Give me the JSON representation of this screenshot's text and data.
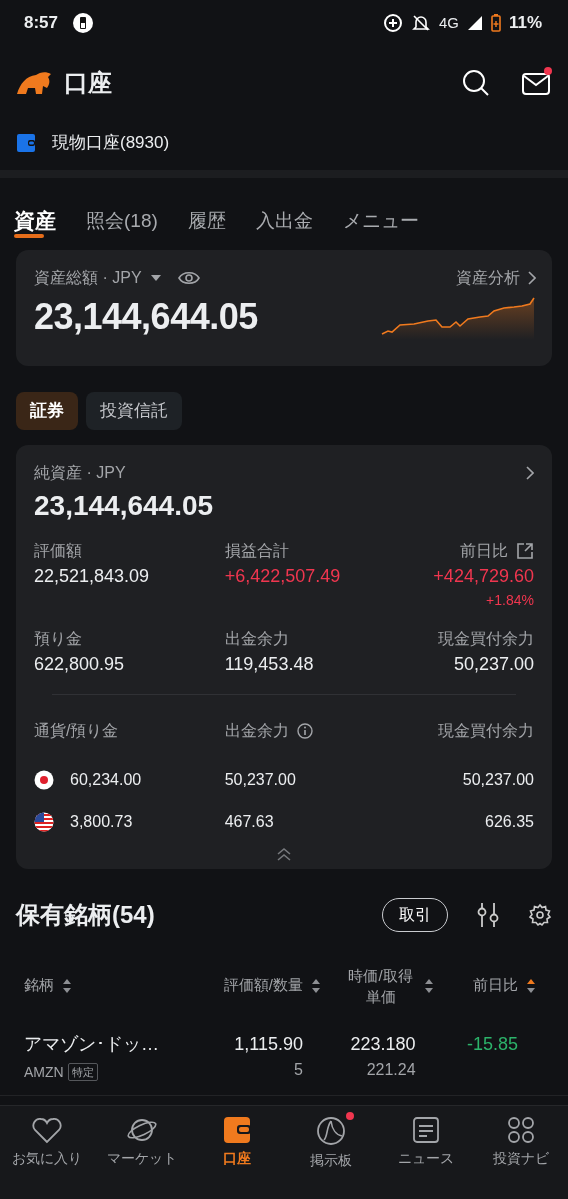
{
  "status_bar": {
    "time": "8:57",
    "network": "4G",
    "battery": "11%"
  },
  "header": {
    "title": "口座",
    "mail_unread": true
  },
  "account": {
    "label": "現物口座(8930)"
  },
  "tabs": [
    {
      "label": "資産",
      "selected": true
    },
    {
      "label": "照会(18)",
      "selected": false
    },
    {
      "label": "履歴",
      "selected": false
    },
    {
      "label": "入出金",
      "selected": false
    },
    {
      "label": "メニュー",
      "selected": false
    }
  ],
  "total": {
    "label": "資産総額 · JPY",
    "link": "資産分析",
    "value": "23,144,644.05"
  },
  "segments": [
    {
      "label": "証券",
      "selected": true
    },
    {
      "label": "投資信託",
      "selected": false
    }
  ],
  "net": {
    "label": "純資産 · JPY",
    "value": "23,144,644.05",
    "metrics": [
      {
        "label": "評価額",
        "value": "22,521,843.09",
        "color": "#eceef0"
      },
      {
        "label": "損益合計",
        "value": "+6,422,507.49",
        "color": "#f0364f"
      },
      {
        "label": "前日比",
        "value": "+424,729.60",
        "sub": "+1.84%",
        "color": "#f0364f",
        "share": true
      },
      {
        "label": "預り金",
        "value": "622,800.95",
        "color": "#eceef0"
      },
      {
        "label": "出金余力",
        "value": "119,453.48",
        "color": "#eceef0"
      },
      {
        "label": "現金買付余力",
        "value": "50,237.00",
        "color": "#eceef0"
      }
    ],
    "currency_columns": [
      "通貨/預り金",
      "出金余力",
      "現金買付余力"
    ],
    "currencies": [
      {
        "kind": "jpy",
        "deposit": "60,234.00",
        "withdrawable": "50,237.00",
        "buying_power": "50,237.00"
      },
      {
        "kind": "usd",
        "deposit": "3,800.73",
        "withdrawable": "467.63",
        "buying_power": "626.35"
      }
    ]
  },
  "holdings": {
    "title": "保有銘柄(54)",
    "trade_button": "取引",
    "columns": [
      {
        "label": "銘柄",
        "sorted": false
      },
      {
        "label": "評価額/数量",
        "sorted": false
      },
      {
        "label": "時価/取得単価",
        "sorted": false
      },
      {
        "label": "前日比",
        "sorted": true
      }
    ],
    "rows": [
      {
        "name": "アマゾン･ドッ…",
        "ticker": "AMZN",
        "tag": "特定",
        "value": "1,115.90",
        "quantity": "5",
        "price": "223.180",
        "cost": "221.24",
        "change": "-15.85",
        "color": "#2cb36a"
      }
    ]
  },
  "nav": [
    {
      "label": "お気に入り",
      "selected": false,
      "badge": false
    },
    {
      "label": "マーケット",
      "selected": false,
      "badge": false
    },
    {
      "label": "口座",
      "selected": true,
      "badge": false
    },
    {
      "label": "掲示板",
      "selected": false,
      "badge": true
    },
    {
      "label": "ニュース",
      "selected": false,
      "badge": false
    },
    {
      "label": "投資ナビ",
      "selected": false,
      "badge": false
    }
  ]
}
